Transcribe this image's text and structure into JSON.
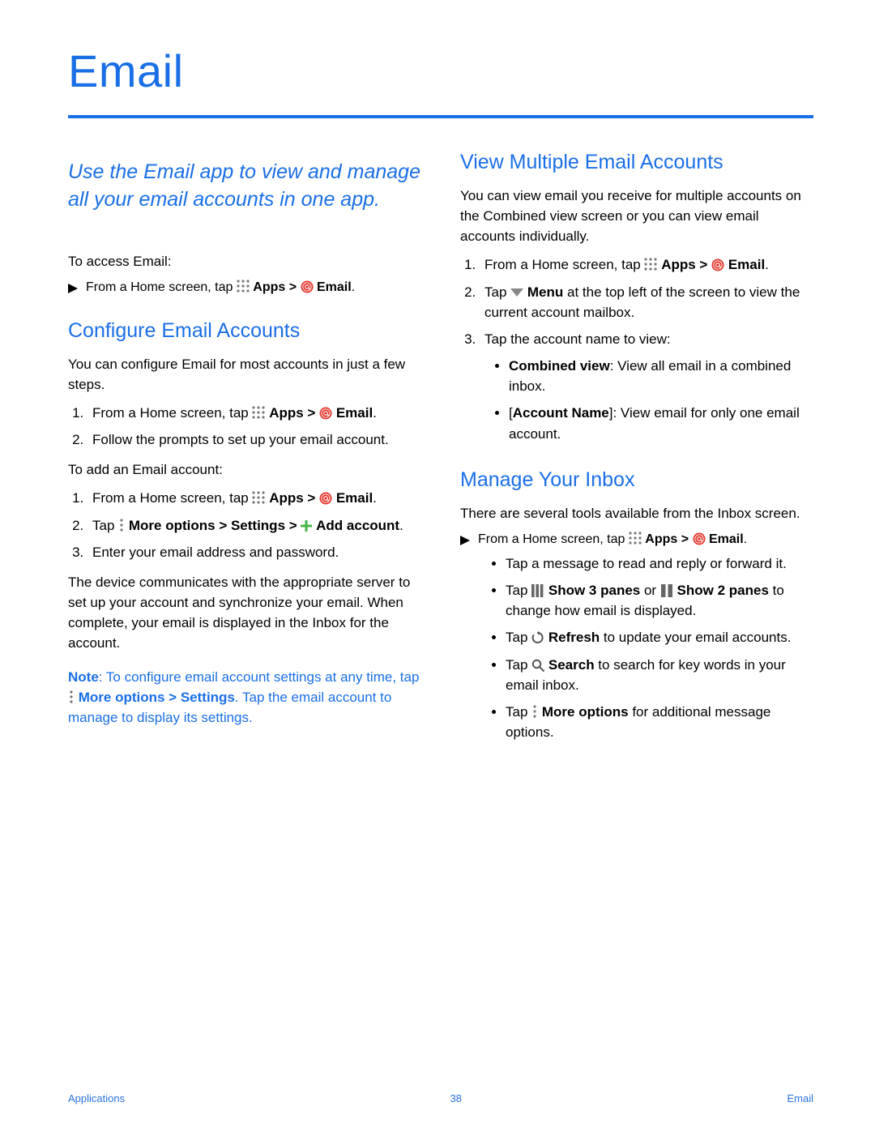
{
  "title": "Email",
  "lede": "Use the Email app to view and manage all your email accounts in one app.",
  "left": {
    "access_intro": "To access Email:",
    "home_prefix": "From a Home screen, tap ",
    "apps_label": "Apps",
    "email_label": "Email",
    "gt": " > ",
    "period": ".",
    "h_configure": "Configure Email Accounts",
    "p_configure": "You can configure Email for most accounts in just a few steps.",
    "step2_follow": "Follow the prompts to set up your email account.",
    "p_add_intro": "To add an Email account:",
    "tap_word": "Tap ",
    "more_settings": "More options > Settings > ",
    "add_account": "Add account",
    "step3_enter": "Enter your email address and password.",
    "p_device": "The device communicates with the appropriate server to set up your account and synchronize your email. When complete, your email is displayed in the Inbox for the account.",
    "note_label": "Note",
    "note_text_a": ": To configure email account settings at any time, tap ",
    "note_more": "More options",
    "note_gt": " > ",
    "note_settings": "Settings",
    "note_text_b": ". Tap the email account to manage to display its settings."
  },
  "right": {
    "h_view": "View Multiple Email Accounts",
    "p_view": "You can view email you receive for multiple accounts on the Combined view screen or you can view email accounts individually.",
    "menu_word": "Menu",
    "step2_menu_tail": " at the top left of the screen to view the current account mailbox.",
    "step3_tap_name": "Tap the account name to view:",
    "combined_view_label": "Combined view",
    "combined_view_text": ": View all email in a combined inbox.",
    "account_name_label": "Account Name",
    "account_name_text": "]: View email for only one email account.",
    "account_name_open": "[",
    "h_manage": "Manage Your Inbox",
    "p_manage": "There are several tools available from the Inbox screen.",
    "b_msg": "Tap a message to read and reply or forward it.",
    "show3_label": "Show 3 panes",
    "show2_label": "Show 2 panes",
    "or_word": " or ",
    "panes_tail": " to change how email is displayed.",
    "refresh_label": "Refresh",
    "refresh_tail": " to update your email accounts.",
    "search_label": "Search",
    "search_tail": " to search for key words in your email inbox.",
    "more_options_label": "More options",
    "more_tail": " for additional message options."
  },
  "footer": {
    "left": "Applications",
    "center": "38",
    "right": "Email"
  }
}
